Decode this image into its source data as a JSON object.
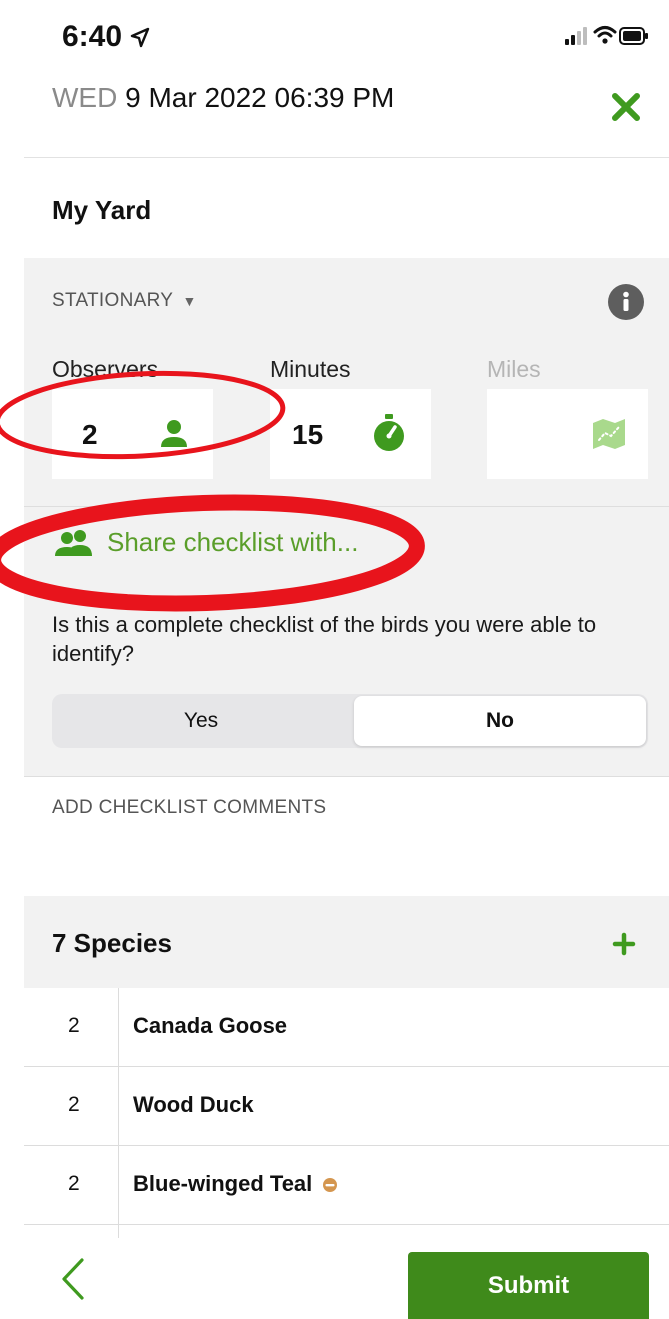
{
  "status_bar": {
    "time": "6:40"
  },
  "header": {
    "day_of_week": "WED",
    "datetime": "9 Mar 2022 06:39 PM"
  },
  "location": "My Yard",
  "protocol": {
    "label": "STATIONARY",
    "caret": "▼"
  },
  "fields": {
    "observers": {
      "label": "Observers",
      "value": "2"
    },
    "minutes": {
      "label": "Minutes",
      "value": "15"
    },
    "miles": {
      "label": "Miles",
      "value": ""
    }
  },
  "share": {
    "label": "Share checklist with..."
  },
  "complete_question": "Is this a complete checklist of the birds you were able to identify?",
  "complete_toggle": {
    "yes_label": "Yes",
    "no_label": "No",
    "selected": "No"
  },
  "comments_placeholder": "ADD CHECKLIST COMMENTS",
  "species": {
    "count_label": "7 Species",
    "items": [
      {
        "count": "2",
        "name": "Canada Goose"
      },
      {
        "count": "2",
        "name": "Wood Duck"
      },
      {
        "count": "2",
        "name": "Blue-winged Teal"
      }
    ]
  },
  "footer": {
    "submit_label": "Submit"
  },
  "colors": {
    "accent_green": "#5a9e2a",
    "submit_green": "#3f8a1b",
    "annotation_red": "#e8141c"
  }
}
